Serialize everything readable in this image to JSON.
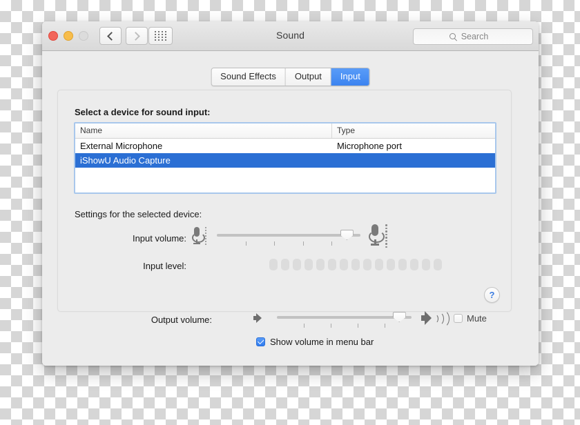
{
  "window": {
    "title": "Sound",
    "traffic_lights": [
      "close",
      "minimize",
      "zoom"
    ],
    "nav": {
      "back_icon": "chevron-left-icon",
      "forward_icon": "chevron-right-icon",
      "showall_icon": "grid-icon"
    },
    "search": {
      "placeholder": "Search",
      "value": "",
      "icon": "search-icon"
    }
  },
  "tabs": [
    {
      "label": "Sound Effects",
      "active": false
    },
    {
      "label": "Output",
      "active": false
    },
    {
      "label": "Input",
      "active": true
    }
  ],
  "panel": {
    "select_label": "Select a device for sound input:",
    "settings_label": "Settings for the selected device:",
    "help_label": "?"
  },
  "device_table": {
    "columns": [
      "Name",
      "Type"
    ],
    "rows": [
      {
        "name": "External Microphone",
        "type": "Microphone port",
        "selected": false
      },
      {
        "name": "iShowU Audio Capture",
        "type": "",
        "selected": true
      }
    ]
  },
  "input_volume": {
    "label": "Input volume:",
    "value_percent": 88,
    "left_icon": "microphone-small-icon",
    "right_icon": "microphone-large-icon",
    "tick_count": 4
  },
  "input_level": {
    "label": "Input level:",
    "segment_count": 15,
    "active_segments": 0
  },
  "output_volume": {
    "label": "Output volume:",
    "value_percent": 88,
    "left_icon": "speaker-mute-icon",
    "right_icon": "speaker-loud-icon",
    "tick_count": 4
  },
  "mute": {
    "label": "Mute",
    "checked": false
  },
  "show_volume": {
    "label": "Show volume in menu bar",
    "checked": true
  },
  "colors": {
    "accent_blue": "#2b6fd4",
    "tab_blue": "#3c84f0",
    "window_bg": "#ececec",
    "table_bg": "#ffffff",
    "help_blue": "#3b7ce0"
  }
}
